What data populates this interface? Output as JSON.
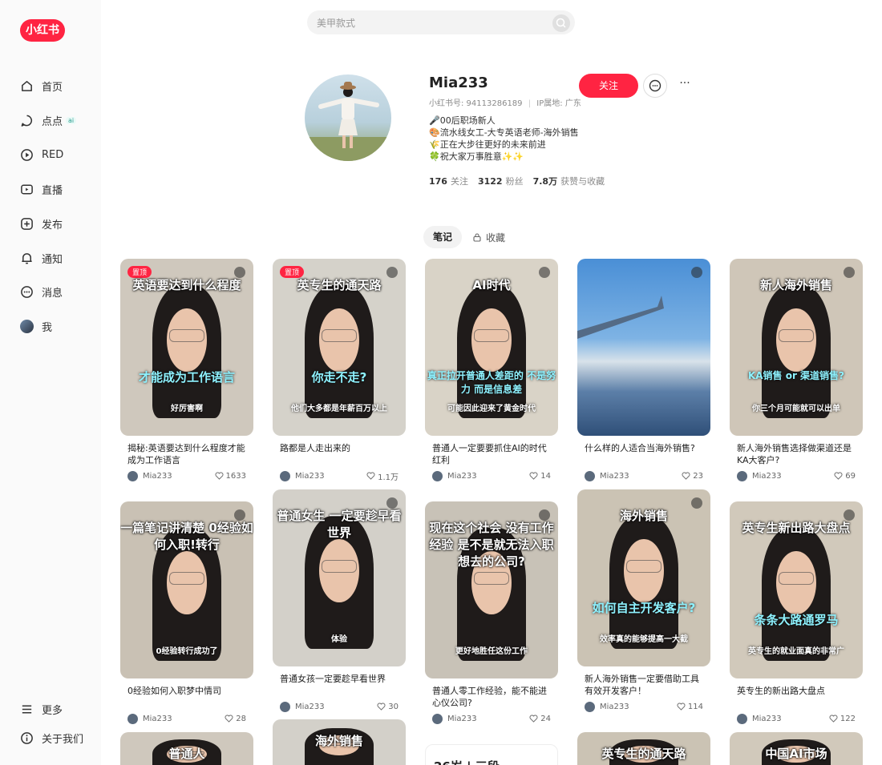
{
  "logo": "小红书",
  "search": {
    "placeholder": "美甲款式"
  },
  "nav": [
    {
      "label": "首页",
      "icon": "home-icon"
    },
    {
      "label": "点点",
      "icon": "chat-bubble-icon",
      "badge": "ai"
    },
    {
      "label": "RED",
      "icon": "play-circle-icon"
    },
    {
      "label": "直播",
      "icon": "live-icon"
    },
    {
      "label": "发布",
      "icon": "plus-icon"
    },
    {
      "label": "通知",
      "icon": "bell-icon"
    },
    {
      "label": "消息",
      "icon": "message-icon"
    },
    {
      "label": "我",
      "icon": "avatar"
    }
  ],
  "nav_bottom": [
    {
      "label": "更多",
      "icon": "menu-icon"
    },
    {
      "label": "关于我们",
      "icon": "info-icon"
    }
  ],
  "profile": {
    "name": "Mia233",
    "id_label": "小红书号: 94113286189",
    "ip_label": "IP属地: 广东",
    "bio": [
      "🎤00后职场新人",
      "🎨流水线女工-大专英语老师-海外销售",
      "🌾正在大步往更好的未来前进",
      "🍀祝大家万事胜意✨✨"
    ],
    "follow_count": "176",
    "follow_label": "关注",
    "fans_count": "3122",
    "fans_label": "粉丝",
    "likes_count": "7.8万",
    "likes_label": "获赞与收藏",
    "follow_btn": "关注",
    "more_glyph": "···"
  },
  "tabs": {
    "notes": "笔记",
    "collect": "收藏"
  },
  "colors": {
    "accent": "#ff2442"
  },
  "cards": [
    {
      "pinned": "置顶",
      "cap_top": "英语要达到什么程度",
      "cap_mid": "才能成为工作语言",
      "cap_bot": "好厉害啊",
      "title": "揭秘:英语要达到什么程度才能成为工作语言",
      "author": "Mia233",
      "likes": "1633",
      "bg": "#cfc8bd"
    },
    {
      "pinned": "置顶",
      "cap_top": "英专生的通天路",
      "cap_mid": "你走不走?",
      "cap_bot": "他们大多都是年薪百万以上",
      "title": "路都是人走出来的",
      "author": "Mia233",
      "likes": "1.1万",
      "bg": "#d5d2ca"
    },
    {
      "cap_top": "AI时代",
      "cap_mid": "真正拉开普通人差距的 不是努力 而是信息差",
      "cap_bot": "可能因此迎来了黄金时代",
      "title": "普通人一定要要抓住AI的时代红利",
      "author": "Mia233",
      "likes": "14",
      "bg": "#d9d3c7"
    },
    {
      "cap_top": "",
      "cap_mid": "",
      "cap_bot": "",
      "title": "什么样的人适合当海外销售?",
      "author": "Mia233",
      "likes": "23",
      "bg": "sky"
    },
    {
      "cap_top": "新人海外销售",
      "cap_mid": "KA销售 or 渠道销售?",
      "cap_bot": "你三个月可能就可以出单",
      "title": "新人海外销售选择做渠道还是KA大客户?",
      "author": "Mia233",
      "likes": "69",
      "bg": "#cfc6b8"
    },
    {
      "cap_top": "一篇笔记讲清楚 0经验如何入职!转行",
      "cap_mid": "",
      "cap_bot": "0经验转行成功了",
      "title": "0经验如何入职梦中情司",
      "author": "Mia233",
      "likes": "28",
      "bg": "#c9c1b4"
    },
    {
      "cap_top": "普通女生 一定要趁早看世界",
      "cap_mid": "",
      "cap_bot": "体验",
      "title": "普通女孩一定要趁早看世界",
      "author": "Mia233",
      "likes": "30",
      "bg": "#d3d0c9"
    },
    {
      "cap_top": "现在这个社会 没有工作经验 是不是就无法入职想去的公司?",
      "cap_mid": "",
      "cap_bot": "更好地胜任这份工作",
      "title": "普通人零工作经验，能不能进心仪公司?",
      "author": "Mia233",
      "likes": "24",
      "bg": "#c8c2b7"
    },
    {
      "cap_top": "海外销售",
      "cap_mid": "如何自主开发客户?",
      "cap_bot": "效率真的能够提高一大截",
      "title": "新人海外销售一定要借助工具有效开发客户！",
      "author": "Mia233",
      "likes": "114",
      "bg": "#cbc3b4"
    },
    {
      "cap_top": "英专生新出路大盘点",
      "cap_mid": "条条大路通罗马",
      "cap_bot": "英专生的就业面真的非常广",
      "title": "英专生的新出路大盘点",
      "author": "Mia233",
      "likes": "122",
      "bg": "#d1c9bb"
    },
    {
      "cap_top": "普通人",
      "title": "",
      "author": "",
      "likes": "",
      "bg": "#cfc8bd"
    },
    {
      "cap_top": "海外销售",
      "title": "",
      "author": "",
      "likes": "",
      "bg": "#d3d0c9"
    },
    {
      "cap_top": "26岁 | 三段",
      "title": "",
      "author": "",
      "likes": "",
      "bg": "#ffffff"
    },
    {
      "cap_top": "英专生的通天路",
      "title": "",
      "author": "",
      "likes": "",
      "bg": "#cbc3b4"
    },
    {
      "cap_top": "中国AI市场",
      "title": "",
      "author": "",
      "likes": "",
      "bg": "#d1c9bb"
    }
  ]
}
